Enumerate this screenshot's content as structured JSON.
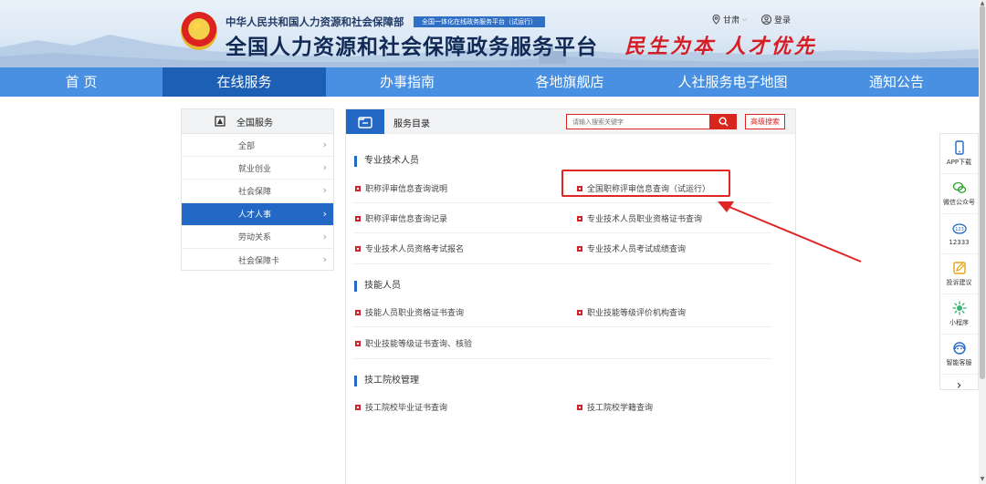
{
  "header": {
    "ministry": "中华人民共和国人力资源和社会保障部",
    "ministry_badge": "全国一体化在线政务服务平台（试运行）",
    "platform_title": "全国人力资源和社会保障政务服务平台",
    "slogan": "民生为本 人才优先",
    "region": "甘肃",
    "login": "登录"
  },
  "nav": {
    "items": [
      {
        "label": "首 页"
      },
      {
        "label": "在线服务"
      },
      {
        "label": "办事指南"
      },
      {
        "label": "各地旗舰店"
      },
      {
        "label": "人社服务电子地图"
      },
      {
        "label": "通知公告"
      }
    ],
    "active": "在线服务"
  },
  "sidebar": {
    "title": "全国服务",
    "items": [
      {
        "label": "全部"
      },
      {
        "label": "就业创业"
      },
      {
        "label": "社会保障"
      },
      {
        "label": "人才人事"
      },
      {
        "label": "劳动关系"
      },
      {
        "label": "社会保障卡"
      }
    ],
    "active": "人才人事"
  },
  "main": {
    "title": "服务目录",
    "search_placeholder": "请输入搜索关键字",
    "advanced_search": "高级搜索",
    "sections": [
      {
        "title": "专业技术人员",
        "items": [
          "职称评审信息查询说明",
          "全国职称评审信息查询（试运行）",
          "职称评审信息查询记录",
          "专业技术人员职业资格证书查询",
          "专业技术人员资格考试报名",
          "专业技术人员考试成绩查询"
        ]
      },
      {
        "title": "技能人员",
        "items": [
          "技能人员职业资格证书查询",
          "职业技能等级评价机构查询",
          "职业技能等级证书查询、核验"
        ]
      },
      {
        "title": "技工院校管理",
        "items": [
          "技工院校毕业证书查询",
          "技工院校学籍查询"
        ]
      }
    ]
  },
  "float_bar": {
    "items": [
      {
        "label": "APP下载",
        "icon": "phone-icon"
      },
      {
        "label": "微信公众号",
        "icon": "wechat-icon"
      },
      {
        "label": "12333",
        "icon": "hotline-icon"
      },
      {
        "label": "投诉建议",
        "icon": "edit-icon"
      },
      {
        "label": "小程序",
        "icon": "miniprogram-icon"
      },
      {
        "label": "智能客服",
        "icon": "customer-service-icon"
      }
    ]
  },
  "colors": {
    "nav_bg": "#4a90e2",
    "nav_active": "#1c5fb4",
    "accent_blue": "#2368c4",
    "accent_red": "#d9261c",
    "annotation_red": "#e02525"
  }
}
